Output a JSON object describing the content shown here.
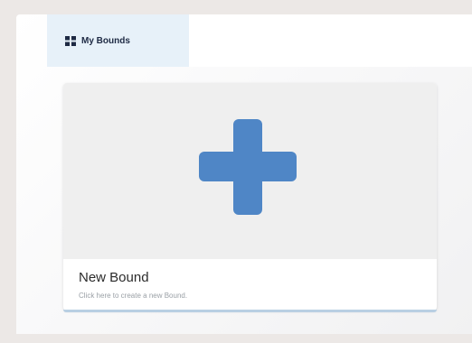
{
  "tab": {
    "label": "My Bounds",
    "icon": "grid-icon"
  },
  "new_bound_card": {
    "icon": "plus-icon",
    "title": "New Bound",
    "description": "Click here to create a new Bound."
  },
  "colors": {
    "accent": "#4f86c6",
    "tab_bg": "#e7f1f9",
    "card_image_bg": "#efefef"
  }
}
